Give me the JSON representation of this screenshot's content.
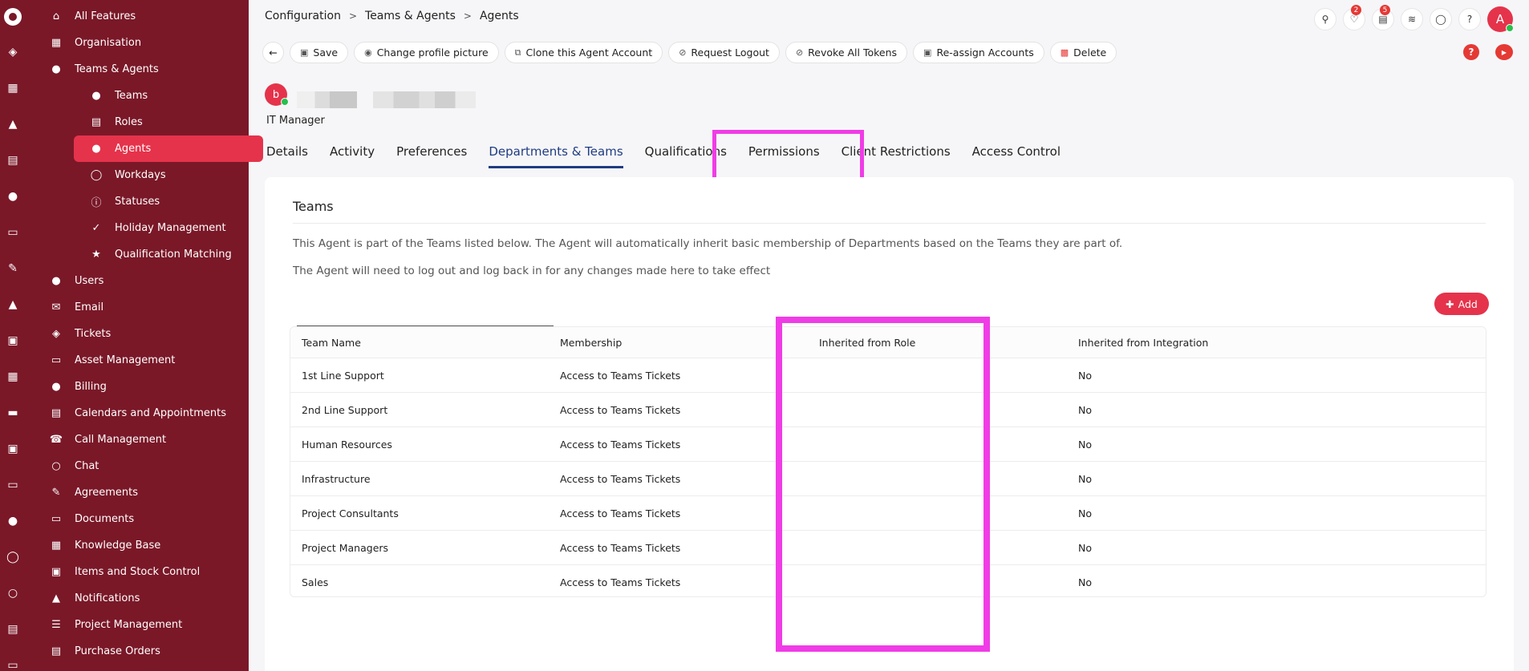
{
  "rail": {
    "icons": [
      "tag-icon",
      "sitemap-icon",
      "chart-icon",
      "calendar-icon",
      "user-icon",
      "laptop-icon",
      "edit-icon",
      "thumbs-up-icon",
      "box-icon",
      "book-icon",
      "truck-icon",
      "cube-icon",
      "document-icon",
      "money-icon",
      "clock-icon",
      "search-icon",
      "report-icon",
      "monitor-icon"
    ]
  },
  "sidebar": {
    "items": [
      {
        "label": "All Features",
        "icon": "home-icon",
        "sub": false
      },
      {
        "label": "Organisation",
        "icon": "building-icon",
        "sub": false
      },
      {
        "label": "Teams & Agents",
        "icon": "user-icon",
        "sub": false
      },
      {
        "label": "Teams",
        "icon": "users-icon",
        "sub": true
      },
      {
        "label": "Roles",
        "icon": "roles-icon",
        "sub": true
      },
      {
        "label": "Agents",
        "icon": "user-icon",
        "sub": true,
        "active": true
      },
      {
        "label": "Workdays",
        "icon": "clock-icon",
        "sub": true
      },
      {
        "label": "Statuses",
        "icon": "info-icon",
        "sub": true
      },
      {
        "label": "Holiday Management",
        "icon": "walking-icon",
        "sub": true
      },
      {
        "label": "Qualification Matching",
        "icon": "medal-icon",
        "sub": true
      },
      {
        "label": "Users",
        "icon": "user-icon",
        "sub": false
      },
      {
        "label": "Email",
        "icon": "email-icon",
        "sub": false
      },
      {
        "label": "Tickets",
        "icon": "ticket-icon",
        "sub": false
      },
      {
        "label": "Asset Management",
        "icon": "laptop-icon",
        "sub": false
      },
      {
        "label": "Billing",
        "icon": "money-bag-icon",
        "sub": false
      },
      {
        "label": "Calendars and Appointments",
        "icon": "calendar-icon",
        "sub": false
      },
      {
        "label": "Call Management",
        "icon": "phone-icon",
        "sub": false
      },
      {
        "label": "Chat",
        "icon": "chat-icon",
        "sub": false
      },
      {
        "label": "Agreements",
        "icon": "agreement-icon",
        "sub": false
      },
      {
        "label": "Documents",
        "icon": "document-icon",
        "sub": false
      },
      {
        "label": "Knowledge Base",
        "icon": "book-icon",
        "sub": false
      },
      {
        "label": "Items and Stock Control",
        "icon": "box-icon",
        "sub": false
      },
      {
        "label": "Notifications",
        "icon": "megaphone-icon",
        "sub": false
      },
      {
        "label": "Project Management",
        "icon": "project-icon",
        "sub": false
      },
      {
        "label": "Purchase Orders",
        "icon": "po-icon",
        "sub": false
      }
    ]
  },
  "breadcrumb": [
    "Configuration",
    "Teams & Agents",
    "Agents"
  ],
  "top_icons": {
    "notifications_count": "2",
    "tasks_count": "5",
    "avatar_letter": "A"
  },
  "toolbar": {
    "buttons": [
      "Save",
      "Change profile picture",
      "Clone this Agent Account",
      "Request Logout",
      "Revoke All Tokens",
      "Re-assign Accounts",
      "Delete"
    ]
  },
  "profile": {
    "avatar_letter": "b",
    "role": "IT Manager"
  },
  "tabs": [
    "Details",
    "Activity",
    "Preferences",
    "Departments & Teams",
    "Qualifications",
    "Permissions",
    "Client Restrictions",
    "Access Control"
  ],
  "active_tab": "Departments & Teams",
  "card": {
    "title": "Teams",
    "text1": "This Agent is part of the Teams listed below. The Agent will automatically inherit basic membership of Departments based on the Teams they are part of.",
    "text2": "The Agent will need to log out and log back in for any changes made here to take effect",
    "add_label": "Add"
  },
  "table": {
    "headers": [
      "Team Name",
      "Membership",
      "Inherited from Role",
      "Inherited from Integration"
    ],
    "rows": [
      [
        "1st Line Support",
        "Access to Teams Tickets",
        "",
        "No"
      ],
      [
        "2nd Line Support",
        "Access to Teams Tickets",
        "",
        "No"
      ],
      [
        "Human Resources",
        "Access to Teams Tickets",
        "",
        "No"
      ],
      [
        "Infrastructure",
        "Access to Teams Tickets",
        "",
        "No"
      ],
      [
        "Project Consultants",
        "Access to Teams Tickets",
        "",
        "No"
      ],
      [
        "Project Managers",
        "Access to Teams Tickets",
        "",
        "No"
      ],
      [
        "Sales",
        "Access to Teams Tickets",
        "",
        "No"
      ]
    ]
  },
  "colors": {
    "sidebar": "#7a1828",
    "accent": "#e5334b",
    "highlight": "#f03ce6",
    "tab_active": "#1f3c80"
  }
}
